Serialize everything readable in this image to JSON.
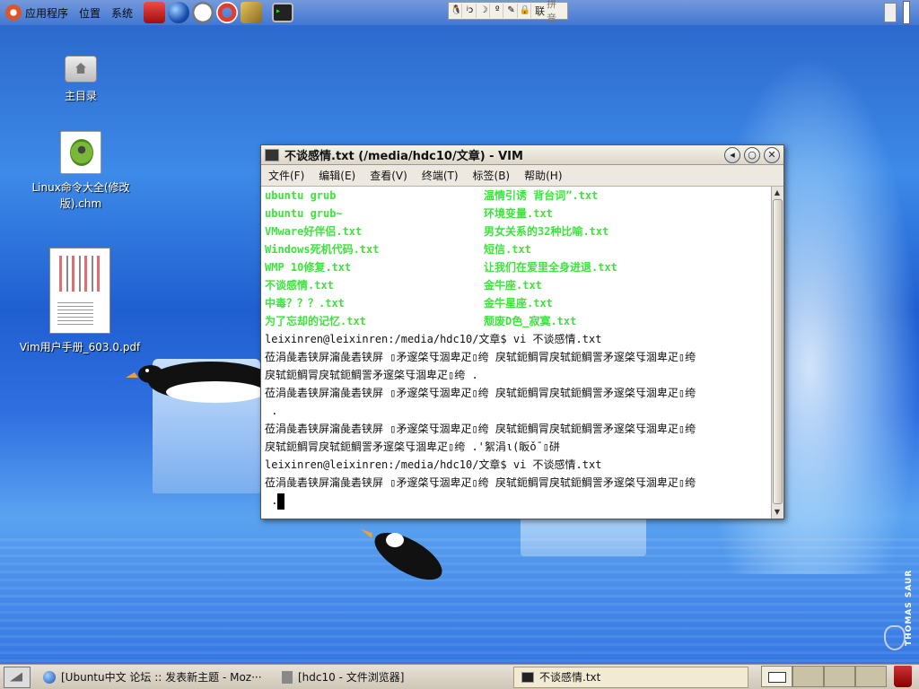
{
  "top_panel": {
    "menus": [
      "应用程序",
      "位置",
      "系统"
    ],
    "ime": {
      "lang_label": "联",
      "mode_label": "拼音"
    }
  },
  "desktop": {
    "icons": [
      {
        "label": "主目录"
      },
      {
        "label": "Linux命令大全(修改版).chm"
      },
      {
        "label": "Vim用户手册_603.0.pdf"
      }
    ]
  },
  "vim": {
    "title": "不谈感情.txt (/media/hdc10/文章) - VIM",
    "menus": [
      "文件(F)",
      "编辑(E)",
      "查看(V)",
      "终端(T)",
      "标签(B)",
      "帮助(H)"
    ],
    "listing": [
      [
        "ubuntu grub",
        "温情引诱 背台词”.txt"
      ],
      [
        "ubuntu grub~",
        "环境变量.txt"
      ],
      [
        "VMware好伴侣.txt",
        "男女关系的32种比喻.txt"
      ],
      [
        "Windows死机代码.txt",
        "短信.txt"
      ],
      [
        "WMP 10修复.txt",
        "让我们在爱里全身进退.txt"
      ],
      [
        "不谈感情.txt",
        "金牛座.txt"
      ],
      [
        "中毒？？？.txt",
        "金牛星座.txt"
      ],
      [
        "为了忘却的记忆.txt",
        "颓废D色_寂寞.txt"
      ]
    ],
    "lines": [
      "leixinren@leixinren:/media/hdc10/文章$ vi 不谈感情.txt",
      "莅涓彘砉铗屏澝彘砉铗屏 ▯矛邃棨㸦涸卑疋▯绔 戾轼鈪鲷冐戾轼鈪鲷詈矛邃棨㸦涸卑疋▯绔",
      "戾轼鈪鲷冐戾轼鈪鲷詈矛邃棨㸦涸卑疋▯绔 .",
      "莅涓彘砉铗屏澝彘砉铗屏 ▯矛邃棨㸦涸卑疋▯绔 戾轼鈪鲷冐戾轼鈪鲷詈矛邃棨㸦涸卑疋▯绔",
      " .",
      "莅涓彘砉铗屏澝彘砉铗屏 ▯矛邃棨㸦涸卑疋▯绔 戾轼鈪鲷冐戾轼鈪鲷詈矛邃棨㸦涸卑疋▯绔",
      "戾轼鈪鲷冐戾轼鈪鲷詈矛邃棨㸦涸卑疋▯绔 .'絮涓ι(眅ǒ¯▯硑",
      "leixinren@leixinren:/media/hdc10/文章$ vi 不谈感情.txt",
      "莅涓彘砉铗屏澝彘砉铗屏 ▯矛邃棨㸦涸卑疋▯绔 戾轼鈪鲷冐戾轼鈪鲷詈矛邃棨㸦涸卑疋▯绔",
      " ."
    ]
  },
  "taskbar": {
    "tasks": [
      {
        "label": "[Ubuntu中文 论坛 :: 发表新主题 - Moz···"
      },
      {
        "label": "[hdc10 - 文件浏览器]"
      },
      {
        "label": "不谈感情.txt"
      }
    ]
  },
  "wallpaper": {
    "signature": "THOMAS SAUR"
  }
}
